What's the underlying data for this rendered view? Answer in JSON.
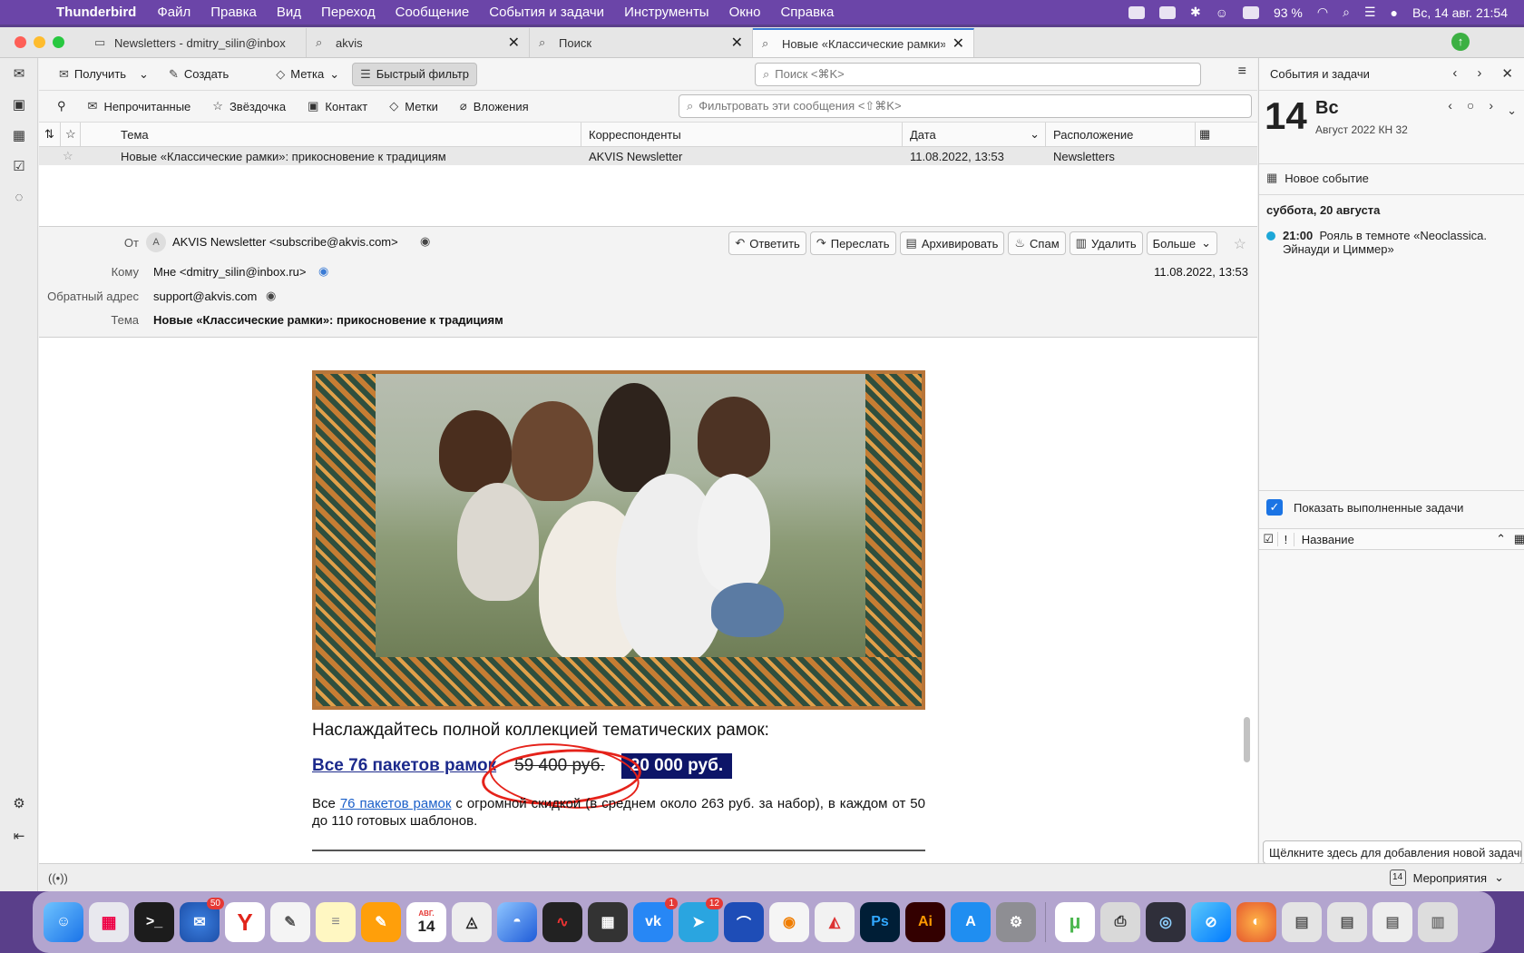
{
  "menubar": {
    "app": "Thunderbird",
    "items": [
      "Файл",
      "Правка",
      "Вид",
      "Переход",
      "Сообщение",
      "События и задачи",
      "Инструменты",
      "Окно",
      "Справка"
    ],
    "battery": "93 %",
    "datetime": "Вс, 14 авг.  21:54"
  },
  "tabs": [
    {
      "label": "Newsletters - dmitry_silin@inbox",
      "icon": "folder-icon"
    },
    {
      "label": "akvis",
      "icon": "search-icon"
    },
    {
      "label": "Поиск",
      "icon": "search-icon"
    },
    {
      "label": "Новые «Классические рамки»",
      "icon": "search-icon"
    }
  ],
  "toolbar": {
    "get": "Получить",
    "write": "Создать",
    "tag": "Метка",
    "quickfilter": "Быстрый фильтр",
    "search_placeholder": "Поиск <⌘K>"
  },
  "filterbar": {
    "unread": "Непрочитанные",
    "starred": "Звёздочка",
    "contact": "Контакт",
    "tags": "Метки",
    "attachments": "Вложения",
    "placeholder": "Фильтровать эти сообщения <⇧⌘K>"
  },
  "columns": {
    "subject": "Тема",
    "correspondents": "Корреспонденты",
    "date": "Дата",
    "location": "Расположение"
  },
  "message_row": {
    "subject": "Новые «Классические рамки»: прикосновение к традициям",
    "from": "AKVIS Newsletter",
    "date": "11.08.2022, 13:53",
    "location": "Newsletters"
  },
  "header": {
    "from_label": "От",
    "from_avatar": "A",
    "from_value": "AKVIS Newsletter <subscribe@akvis.com>",
    "to_label": "Кому",
    "to_value": "Мне <dmitry_silin@inbox.ru>",
    "replyto_label": "Обратный адрес",
    "replyto_value": "support@akvis.com",
    "subject_label": "Тема",
    "subject_value": "Новые «Классические рамки»: прикосновение к традициям",
    "date": "11.08.2022, 13:53",
    "buttons": {
      "reply": "Ответить",
      "forward": "Переслать",
      "archive": "Архивировать",
      "junk": "Спам",
      "delete": "Удалить",
      "more": "Больше"
    }
  },
  "body": {
    "lead": "Наслаждайтесь полной коллекцией тематических рамок:",
    "all_packs_link": "Все 76 пакетов рамок",
    "old_price": "59 400 руб.",
    "new_price": "20 000 руб.",
    "para_start": "Все ",
    "para_link": "76 пакетов рамок",
    "para_rest": " с огромной скидкой (в среднем около 263 руб. за набор), в каждом от 50 до 110 готовых шаблонов."
  },
  "calendar": {
    "pane_title": "События и задачи",
    "day_number": "14",
    "day_name": "Вс",
    "month_week": "Август 2022  КН 32",
    "new_event": "Новое событие",
    "agenda_day": "суббота, 20 августа",
    "event_time": "21:00",
    "event_title": "Рояль в темноте «Neoclassica. Эйнауди и Циммер»",
    "show_done": "Показать выполненные задачи",
    "task_col_name": "Название",
    "add_task": "Щёлкните здесь для добавления новой задачи"
  },
  "statusbar": {
    "view_label": "Мероприятия",
    "calendar_badge": "14"
  },
  "dock": {
    "thunderbird_badge": "50",
    "calendar_month": "АВГ.",
    "calendar_day": "14",
    "vk_badge": "1",
    "telegram_badge": "12"
  },
  "colors": {
    "accent": "#1b74e4",
    "event_dot": "#1da7d8",
    "price_bg": "#0d1568",
    "scribble": "#e5221a"
  }
}
